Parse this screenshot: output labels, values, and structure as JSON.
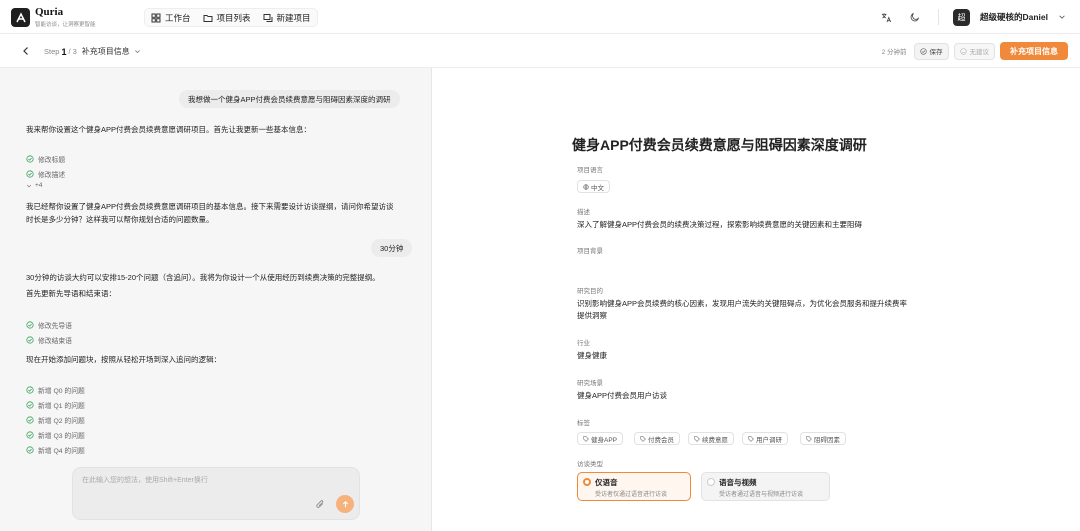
{
  "app": {
    "name": "Quria",
    "tagline": "智能访谈，让洞察更智能"
  },
  "nav": {
    "items": [
      {
        "label": "工作台",
        "icon": "grid-icon"
      },
      {
        "label": "项目列表",
        "icon": "folder-icon"
      },
      {
        "label": "新建项目",
        "icon": "new-chat-icon"
      }
    ]
  },
  "user": {
    "avatar_text": "超",
    "name": "超级硬核的Daniel"
  },
  "subbar": {
    "step_prefix": "Step",
    "step_current": "1",
    "step_total": "/ 3",
    "step_title": "补充项目信息",
    "time_ago": "2 分钟前",
    "save_label": "保存",
    "no_suggest_label": "无建议",
    "primary_label": "补充项目信息"
  },
  "chat": {
    "user_msg_1": "我想做一个健身APP付费会员续费意愿与阻碍因素深度的调研",
    "ai_msg_1": "我来帮你设置这个健身APP付费会员续费意愿调研项目。首先让我更新一些基本信息：",
    "checks_1": [
      "修改标题",
      "修改描述"
    ],
    "more_1": "+4",
    "ai_msg_2_line1": "我已经帮你设置了健身APP付费会员续费意愿调研项目的基本信息。接下来需要设计访谈提纲，请问你希望访谈",
    "ai_msg_2_line2": "时长是多少分钟？这样我可以帮你规划合适的问题数量。",
    "user_msg_2": "30分钟",
    "ai_msg_3_line1": "30分钟的访谈大约可以安排15-20个问题（含追问）。我将为你设计一个从使用经历到续费决策的完整提纲。",
    "ai_msg_3_line2": "首先更新先导语和结束语：",
    "checks_2": [
      "修改先导语",
      "修改结束语"
    ],
    "ai_msg_4": "现在开始添加问题块，按照从轻松开场到深入追问的逻辑：",
    "checks_3": [
      "新增 Q0 的问题",
      "新增 Q1 的问题",
      "新增 Q2 的问题",
      "新增 Q3 的问题",
      "新增 Q4 的问题"
    ],
    "input_placeholder": "在此输入您的想法，使用Shift+Enter换行"
  },
  "project": {
    "title": "健身APP付费会员续费意愿与阻碍因素深度调研",
    "language_label": "项目语言",
    "language_value": "中文",
    "desc_label": "描述",
    "desc_value": "深入了解健身APP付费会员的续费决策过程，探索影响续费意愿的关键因素和主要阻碍",
    "background_label": "项目背景",
    "goal_label": "研究目的",
    "goal_line1": "识别影响健身APP会员续费的核心因素，发现用户流失的关键阻碍点，为优化会员服务和提升续费率",
    "goal_line2": "提供洞察",
    "industry_label": "行业",
    "industry_value": "健身健康",
    "scenario_label": "研究场景",
    "scenario_value": "健身APP付费会员用户访谈",
    "tags_label": "标签",
    "tags": [
      "健身APP",
      "付费会员",
      "续费意愿",
      "用户调研",
      "阻碍因素"
    ],
    "interview_type_label": "访谈类型",
    "options": [
      {
        "title": "仅语音",
        "desc": "受访者仅通过语音进行访谈"
      },
      {
        "title": "语音与视频",
        "desc": "受访者通过语音与视频进行访谈"
      }
    ]
  }
}
